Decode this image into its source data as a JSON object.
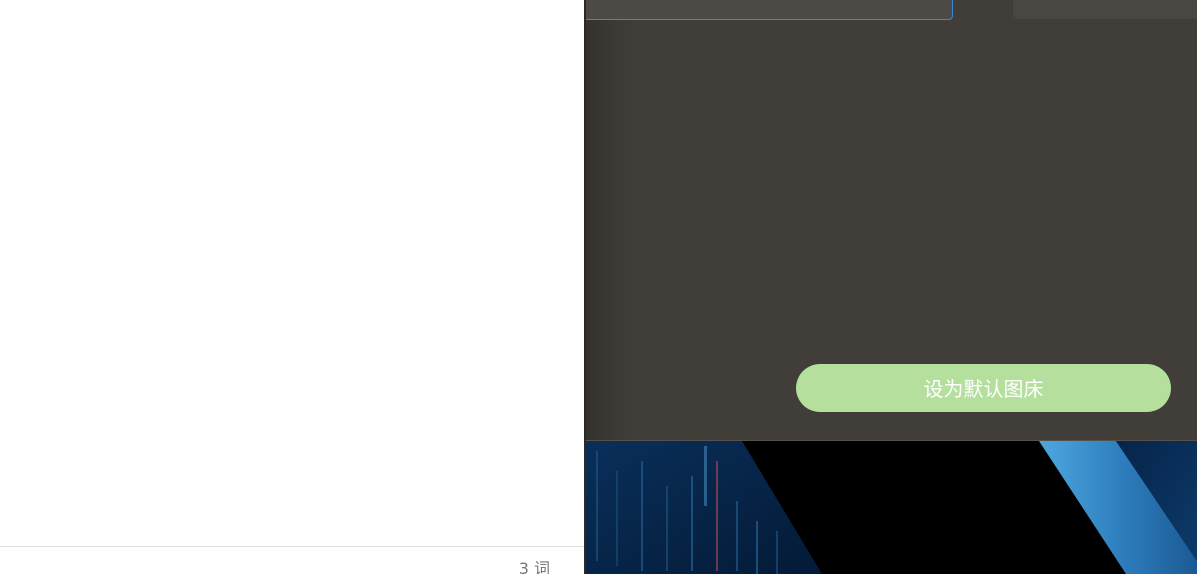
{
  "editor": {
    "word_count": "3 词"
  },
  "settings": {
    "set_default_button": "设为默认图床"
  },
  "wallpaper": {
    "description_colors": {
      "deep_blue": "#062a4f",
      "accent_blue": "#3a8fc8",
      "black": "#000000"
    }
  },
  "colors": {
    "settings_background": "#413d38",
    "button_green": "#b5df9c",
    "focus_border": "#3b87d8"
  }
}
